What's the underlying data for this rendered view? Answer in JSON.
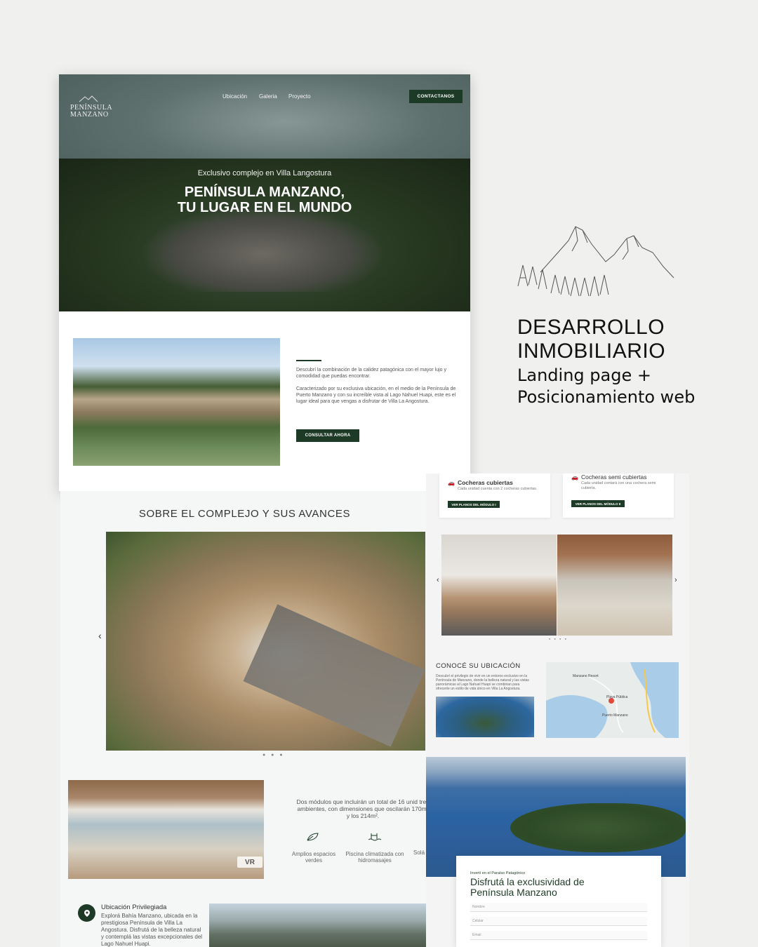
{
  "site": {
    "logo_line1": "PENÍNSULA",
    "logo_line2": "MANZANO",
    "nav": [
      "Ubicación",
      "Galeria",
      "Proyecto"
    ],
    "cta_top": "CONTACTANOS",
    "hero_sub": "Exclusivo complejo en Villa Langostura",
    "hero_title_1": "PENÍNSULA MANZANO,",
    "hero_title_2": "TU LUGAR EN EL MUNDO",
    "intro_p1": "Descubrí la combinación de la calidez patagónica con el mayor lujo y comodidad que puedas encontrar.",
    "intro_p2": "Caracterizado por su exclusiva ubicación, en el medio de la Península de Puerto Manzano y con su increíble vista al Lago Nahuel Huapi, este es el lugar ideal para que vengas a disfrutar de Villa La Angostura.",
    "intro_btn": "CONSULTAR AHORA"
  },
  "complejo": {
    "title": "SOBRE EL COMPLEJO Y SUS AVANCES",
    "modules_text": "Dos módulos que incluirán un total de 16 unid tres ambientes, con dimensiones que oscilarán 170m² y los 214m².",
    "vr": "VR",
    "features": [
      "Amplios espacios verdes",
      "Piscina climatizada con hidromasajes",
      "Solá"
    ],
    "ub_title": "Ubicación Privilegiada",
    "ub_text": "Explorá Bahía Manzano, ubicada en la prestigiosa Península de Villa La Angostura. Disfrutá de la belleza natural y contemplá las vistas excepcionales del Lago Nahuel Huapi."
  },
  "detalles": {
    "card1_title": "Cocheras cubiertas",
    "card1_sub": "Cada unidad cuenta con 2 cocheras cubiertas.",
    "card1_btn": "VER PLANOS DEL MÓDULO I",
    "card2_title": "Cocheras semi cubiertas",
    "card2_sub": "Cada unidad contará con una cochera semi cubierta.",
    "card2_btn": "VER PLANOS DEL MÓDULO II",
    "ubic_title": "CONOCÉ SU UBICACIÓN",
    "ubic_text": "Descubrí el privilegio de vivir en un entorno exclusivo en la Península de Manzano, donde la belleza natural y las vistas panorámicas al Lago Nahuel Huapi se combinan para ofrecerte un estilo de vida único en Villa La Angostura.",
    "map_labels": [
      "Puerto Manzano",
      "Playa Pública",
      "Manzano Resort"
    ],
    "form_kicker": "Invertí en el Paraíso Patagónico",
    "form_title_1": "Disfrutá la exclusividad de",
    "form_title_2": "Península Manzano",
    "form_fields": [
      "Nombre",
      "Celular",
      "Email"
    ]
  },
  "promo": {
    "title_1": "DESARROLLO",
    "title_2": "INMOBILIARIO",
    "sub_1": "Landing page +",
    "sub_2": "Posicionamiento web"
  },
  "colors": {
    "brand_green": "#1d3a26",
    "background": "#f0f0ef"
  }
}
